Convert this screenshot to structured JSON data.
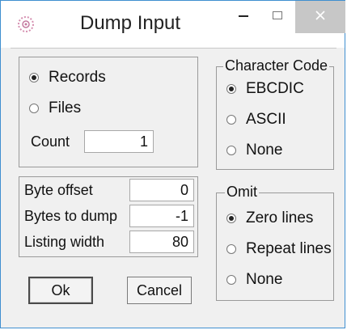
{
  "window": {
    "title": "Dump Input",
    "controls": {
      "minimize": "–",
      "maximize": "☐",
      "close": "✕"
    }
  },
  "dump_type": {
    "options": [
      {
        "label": "Records",
        "selected": true
      },
      {
        "label": "Files",
        "selected": false
      }
    ],
    "count_label": "Count",
    "count_value": "1"
  },
  "offsets": {
    "byte_offset_label": "Byte offset",
    "byte_offset_value": "0",
    "bytes_to_dump_label": "Bytes to dump",
    "bytes_to_dump_value": "-1",
    "listing_width_label": "Listing width",
    "listing_width_value": "80"
  },
  "character_code": {
    "title": "Character Code",
    "options": [
      {
        "label": "EBCDIC",
        "selected": true
      },
      {
        "label": "ASCII",
        "selected": false
      },
      {
        "label": "None",
        "selected": false
      }
    ]
  },
  "omit": {
    "title": "Omit",
    "options": [
      {
        "label": "Zero lines",
        "selected": true
      },
      {
        "label": "Repeat lines",
        "selected": false
      },
      {
        "label": "None",
        "selected": false
      }
    ]
  },
  "buttons": {
    "ok": "Ok",
    "cancel": "Cancel"
  },
  "colors": {
    "window_border": "#3f8fd0",
    "close_button_bg": "#c7c7c7",
    "dialog_bg": "#f0f0f0"
  }
}
